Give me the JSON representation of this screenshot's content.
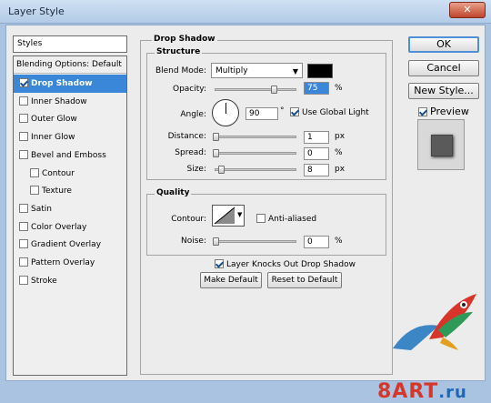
{
  "window": {
    "title": "Layer Style",
    "close_glyph": "✕"
  },
  "styles": {
    "header": "Styles",
    "blending_options": "Blending Options: Default",
    "items": [
      {
        "label": "Drop Shadow",
        "checked": true,
        "selected": true,
        "sub": false
      },
      {
        "label": "Inner Shadow",
        "checked": false,
        "selected": false,
        "sub": false
      },
      {
        "label": "Outer Glow",
        "checked": false,
        "selected": false,
        "sub": false
      },
      {
        "label": "Inner Glow",
        "checked": false,
        "selected": false,
        "sub": false
      },
      {
        "label": "Bevel and Emboss",
        "checked": false,
        "selected": false,
        "sub": false
      },
      {
        "label": "Contour",
        "checked": false,
        "selected": false,
        "sub": true
      },
      {
        "label": "Texture",
        "checked": false,
        "selected": false,
        "sub": true
      },
      {
        "label": "Satin",
        "checked": false,
        "selected": false,
        "sub": false
      },
      {
        "label": "Color Overlay",
        "checked": false,
        "selected": false,
        "sub": false
      },
      {
        "label": "Gradient Overlay",
        "checked": false,
        "selected": false,
        "sub": false
      },
      {
        "label": "Pattern Overlay",
        "checked": false,
        "selected": false,
        "sub": false
      },
      {
        "label": "Stroke",
        "checked": false,
        "selected": false,
        "sub": false
      }
    ]
  },
  "drop_shadow": {
    "title": "Drop Shadow",
    "structure": {
      "title": "Structure",
      "blend_mode_label": "Blend Mode:",
      "blend_mode_value": "Multiply",
      "shadow_color": "#000000",
      "opacity_label": "Opacity:",
      "opacity_value": "75",
      "opacity_unit": "%",
      "angle_label": "Angle:",
      "angle_value": "90",
      "angle_unit": "°",
      "use_global_light_label": "Use Global Light",
      "use_global_light_checked": true,
      "distance_label": "Distance:",
      "distance_value": "1",
      "distance_unit": "px",
      "spread_label": "Spread:",
      "spread_value": "0",
      "spread_unit": "%",
      "size_label": "Size:",
      "size_value": "8",
      "size_unit": "px"
    },
    "quality": {
      "title": "Quality",
      "contour_label": "Contour:",
      "anti_aliased_label": "Anti-aliased",
      "anti_aliased_checked": false,
      "noise_label": "Noise:",
      "noise_value": "0",
      "noise_unit": "%"
    },
    "knocks_out_label": "Layer Knocks Out Drop Shadow",
    "knocks_out_checked": true,
    "make_default_label": "Make Default",
    "reset_default_label": "Reset to Default"
  },
  "actions": {
    "ok_label": "OK",
    "cancel_label": "Cancel",
    "new_style_label": "New Style...",
    "preview_label": "Preview",
    "preview_checked": true
  },
  "watermark": {
    "brand": "8ART",
    "tld": ".ru"
  },
  "colors": {
    "selection": "#3a86d8",
    "title_bar": "#b3cbe7"
  }
}
